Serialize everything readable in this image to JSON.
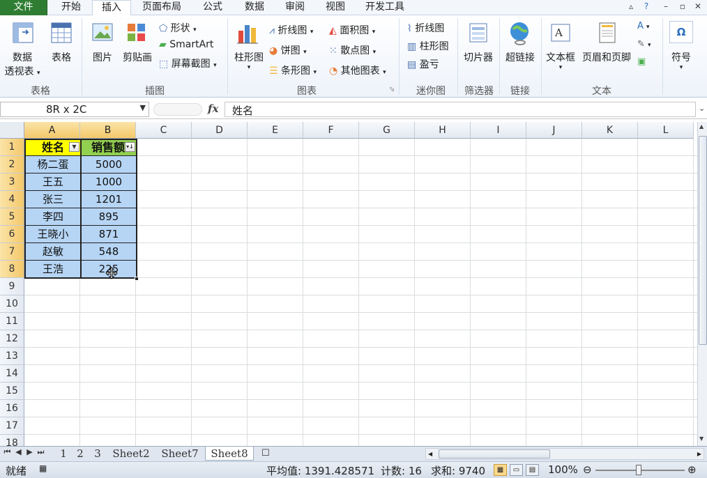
{
  "tabs": [
    "文件",
    "开始",
    "插入",
    "页面布局",
    "公式",
    "数据",
    "审阅",
    "视图",
    "开发工具"
  ],
  "active_tab": "插入",
  "ribbon": {
    "tables": {
      "pivot1": "数据",
      "pivot2": "透视表",
      "table": "表格",
      "label": "表格"
    },
    "illustrations": {
      "picture": "图片",
      "clipart": "剪贴画",
      "shapes": "形状",
      "smartart": "SmartArt",
      "screenshot": "屏幕截图",
      "label": "插图"
    },
    "charts": {
      "column": "柱形图",
      "line": "折线图",
      "pie": "饼图",
      "bar": "条形图",
      "area": "面积图",
      "scatter": "散点图",
      "other": "其他图表",
      "label": "图表"
    },
    "sparklines": {
      "line": "折线图",
      "column": "柱形图",
      "winloss": "盈亏",
      "label": "迷你图"
    },
    "filter": {
      "slicer": "切片器",
      "label": "筛选器"
    },
    "links": {
      "hyperlink": "超链接",
      "label": "链接"
    },
    "text": {
      "textbox": "文本框",
      "header_footer": "页眉和页脚",
      "label": "文本"
    },
    "symbols": {
      "symbol": "符号"
    }
  },
  "formula_bar": {
    "name_box": "8R x 2C",
    "fx": "fx",
    "content": "姓名"
  },
  "columns": [
    "A",
    "B",
    "C",
    "D",
    "E",
    "F",
    "G",
    "H",
    "I",
    "J",
    "K",
    "L"
  ],
  "rows": [
    "1",
    "2",
    "3",
    "4",
    "5",
    "6",
    "7",
    "8",
    "9",
    "10",
    "11",
    "12",
    "13",
    "14",
    "15",
    "16",
    "17",
    "18"
  ],
  "table": {
    "header_a": "姓名",
    "header_b": "销售额",
    "names": [
      "杨二蛋",
      "王五",
      "张三",
      "李四",
      "王晓小",
      "赵敏",
      "王浩"
    ],
    "sales": [
      "5000",
      "1000",
      "1201",
      "895",
      "871",
      "548",
      "225"
    ]
  },
  "sheets": [
    "1",
    "2",
    "3",
    "Sheet2",
    "Sheet7",
    "Sheet8"
  ],
  "active_sheet": "Sheet8",
  "status": {
    "ready": "就绪",
    "average": "平均值: 1391.428571",
    "count": "计数: 16",
    "sum": "求和: 9740",
    "zoom": "100%"
  },
  "colors": {
    "header_a": "#ffff00",
    "header_b": "#92d050",
    "body": "#b6d5f5",
    "file_tab": "#2f7d32"
  }
}
